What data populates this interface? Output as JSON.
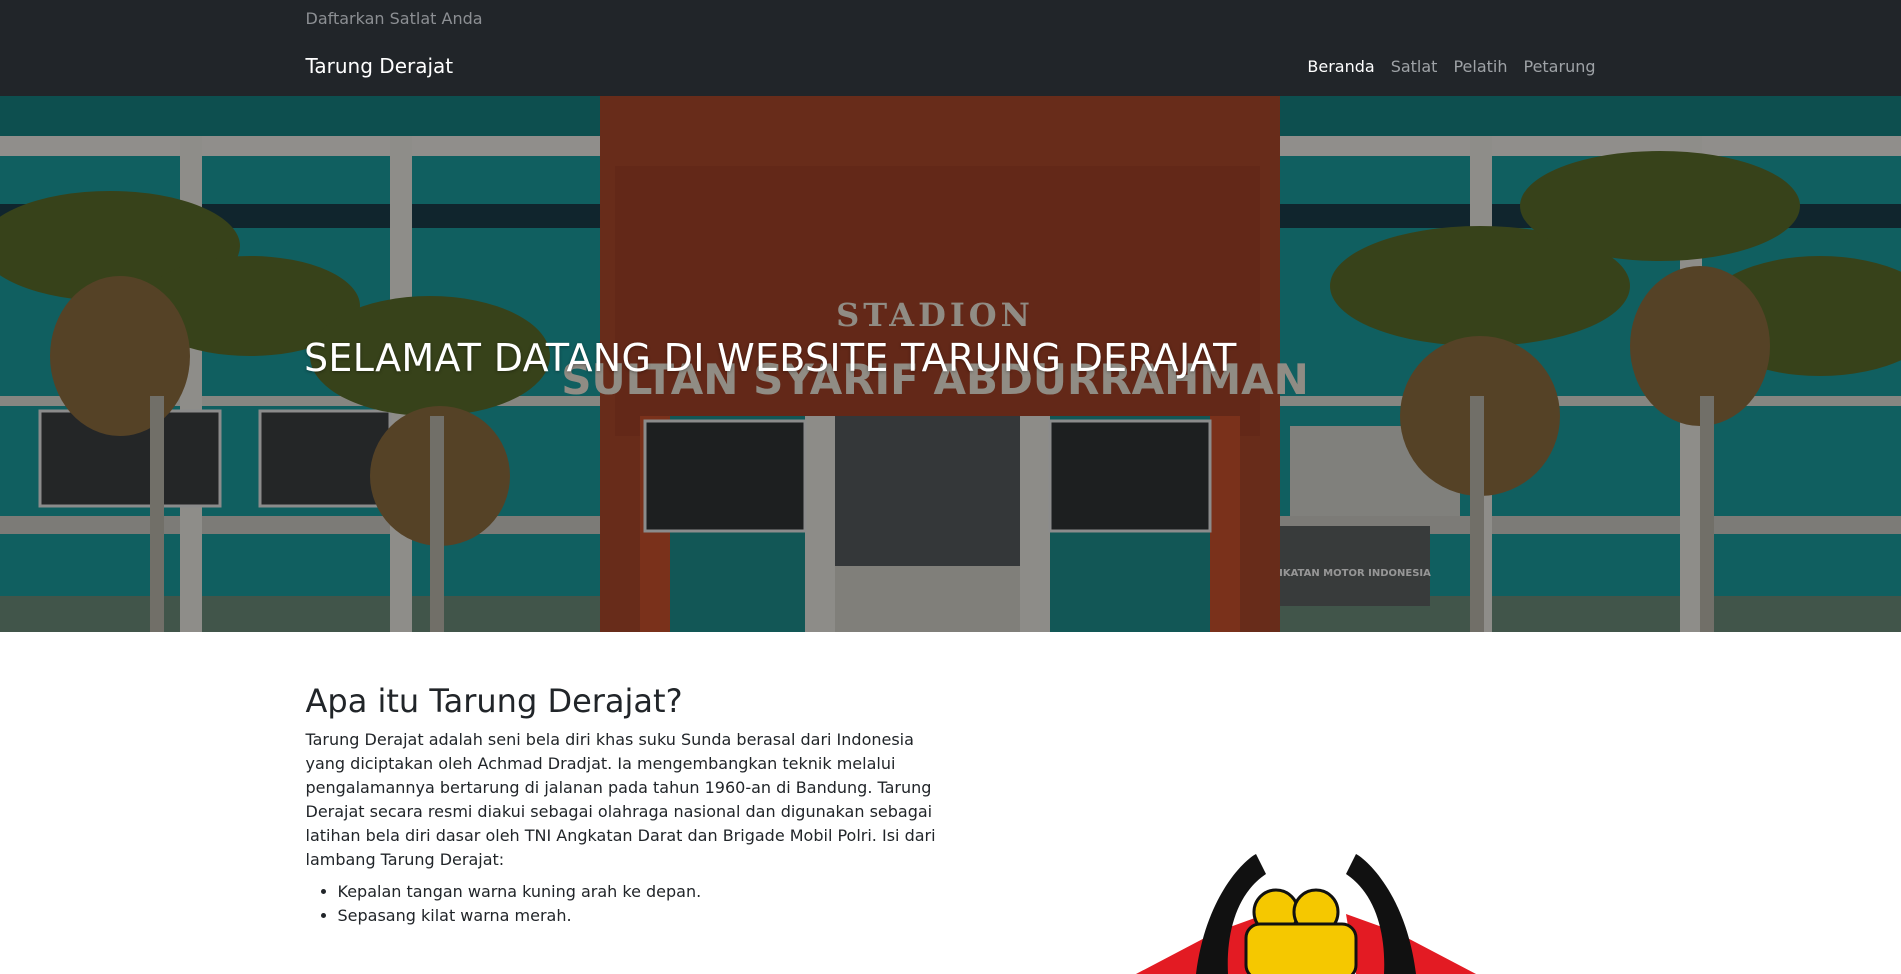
{
  "header": {
    "register_link": "Daftarkan Satlat Anda",
    "brand": "Tarung Derajat",
    "nav": [
      {
        "label": "Beranda",
        "active": true
      },
      {
        "label": "Satlat",
        "active": false
      },
      {
        "label": "Pelatih",
        "active": false
      },
      {
        "label": "Petarung",
        "active": false
      }
    ]
  },
  "hero": {
    "title": "SELAMAT DATANG DI WEBSITE TARUNG DERAJAT",
    "sign_line1": "STADION",
    "sign_line2": "SULTAN SYARIF ABDURRAHMAN",
    "side_sign": "IKATAN MOTOR INDONESIA"
  },
  "about": {
    "heading": "Apa itu Tarung Derajat?",
    "paragraph": "Tarung Derajat adalah seni bela diri khas suku Sunda berasal dari Indonesia yang diciptakan oleh Achmad Dradjat. Ia mengembangkan teknik melalui pengalamannya bertarung di jalanan pada tahun 1960-an di Bandung. Tarung Derajat secara resmi diakui sebagai olahraga nasional dan digunakan sebagai latihan bela diri dasar oleh TNI Angkatan Darat dan Brigade Mobil Polri. Isi dari lambang Tarung Derajat:",
    "list": [
      "Kepalan tangan warna kuning arah ke depan.",
      "Sepasang kilat warna merah."
    ]
  },
  "colors": {
    "navbar_bg": "#212529",
    "emblem_yellow": "#f5c800",
    "emblem_red": "#e31b23"
  }
}
